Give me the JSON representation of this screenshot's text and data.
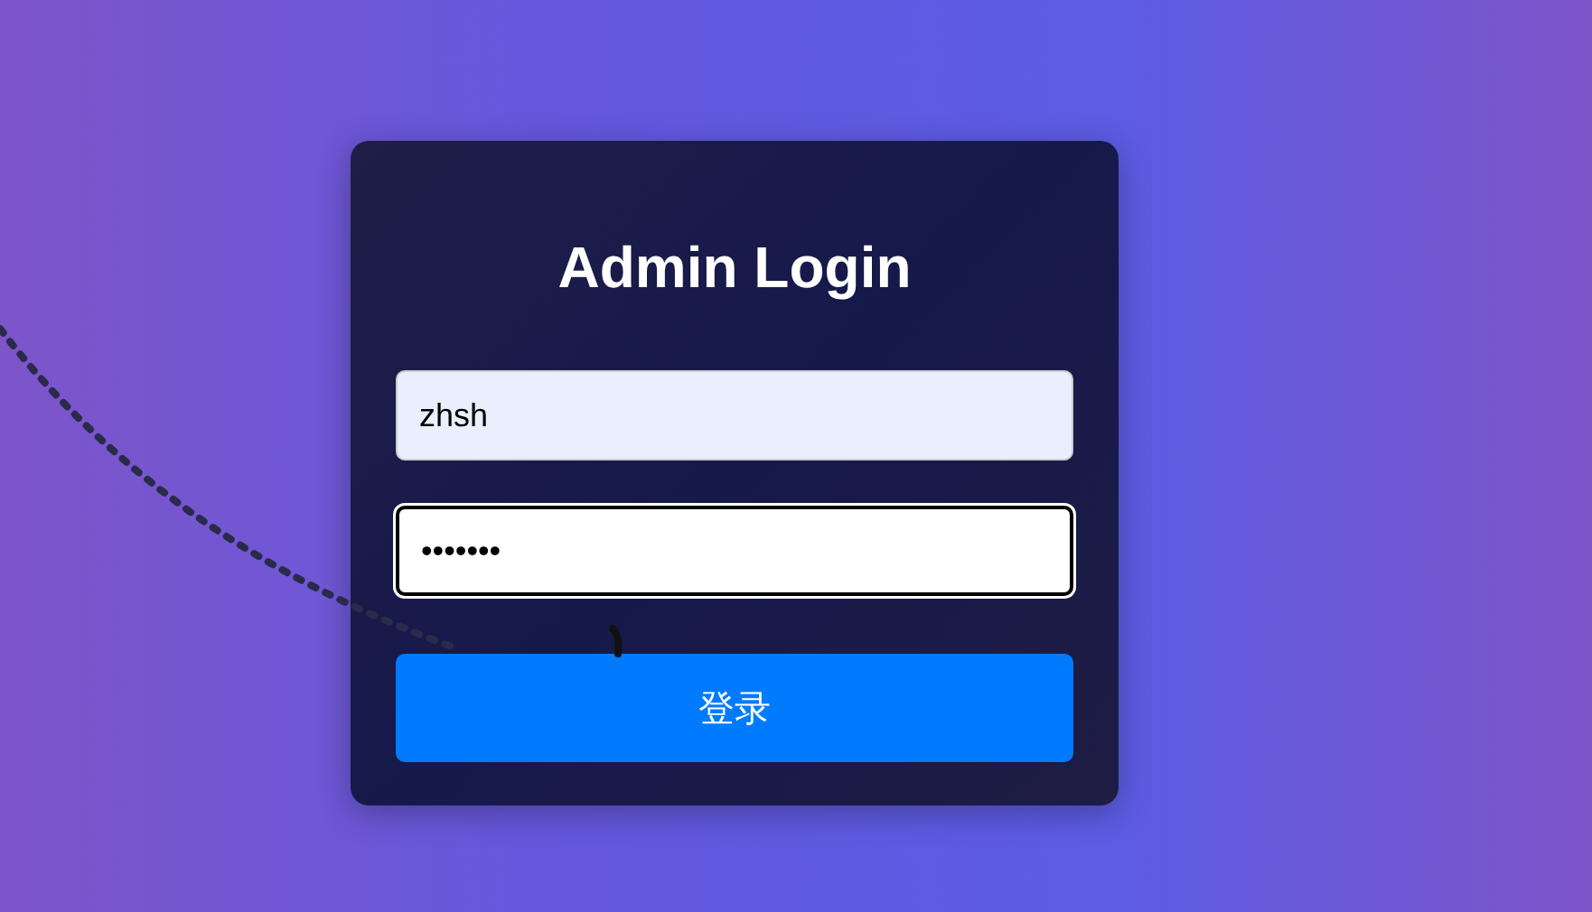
{
  "login_form": {
    "title": "Admin Login",
    "fields": [
      {
        "kind": "text",
        "value": "zhsh",
        "focused": false
      },
      {
        "kind": "password",
        "value": "•••••••",
        "focused": true
      }
    ],
    "submit_button": "登录"
  }
}
